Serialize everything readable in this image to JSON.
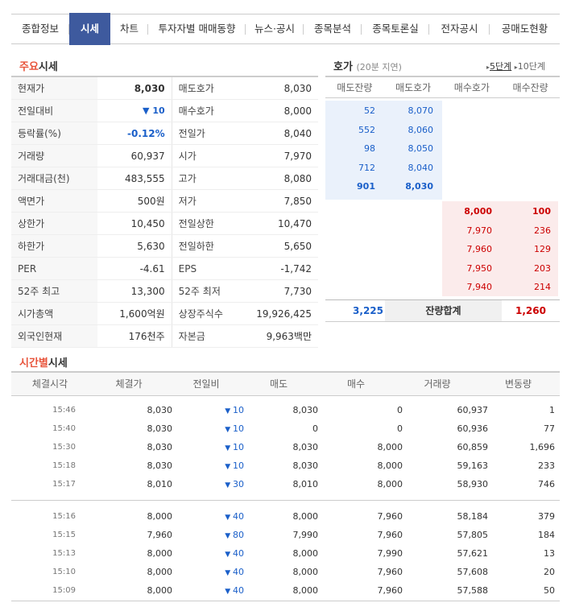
{
  "tabs": [
    "종합정보",
    "시세",
    "차트",
    "투자자별 매매동향",
    "뉴스·공시",
    "종목분석",
    "종목토론실",
    "전자공시",
    "공매도현황"
  ],
  "active_tab": "시세",
  "main_title": {
    "red": "주요",
    "rest": "시세"
  },
  "quote": [
    {
      "l1": "현재가",
      "v1": "8,030",
      "l2": "매도호가",
      "v2": "8,030"
    },
    {
      "l1": "전일대비",
      "v1": "▼ 10",
      "l2": "매수호가",
      "v2": "8,000"
    },
    {
      "l1": "등락률(%)",
      "v1": "-0.12%",
      "l2": "전일가",
      "v2": "8,040"
    },
    {
      "l1": "거래량",
      "v1": "60,937",
      "l2": "시가",
      "v2": "7,970"
    },
    {
      "l1": "거래대금(천)",
      "v1": "483,555",
      "l2": "고가",
      "v2": "8,080"
    },
    {
      "l1": "액면가",
      "v1": "500원",
      "l2": "저가",
      "v2": "7,850"
    },
    {
      "l1": "상한가",
      "v1": "10,450",
      "l2": "전일상한",
      "v2": "10,470"
    },
    {
      "l1": "하한가",
      "v1": "5,630",
      "l2": "전일하한",
      "v2": "5,650"
    },
    {
      "l1": "PER",
      "v1": "-4.61",
      "l2": "EPS",
      "v2": "-1,742"
    },
    {
      "l1": "52주 최고",
      "v1": "13,300",
      "l2": "52주 최저",
      "v2": "7,730"
    },
    {
      "l1": "시가총액",
      "v1": "1,600억원",
      "l2": "상장주식수",
      "v2": "19,926,425"
    },
    {
      "l1": "외국인현재",
      "v1": "176천주",
      "l2": "자본금",
      "v2": "9,963백만"
    }
  ],
  "book": {
    "title": "호가",
    "delay": "(20분 지연)",
    "step5": "5단계",
    "step10": "10단계",
    "headers": [
      "매도잔량",
      "매도호가",
      "매수호가",
      "매수잔량"
    ],
    "asks": [
      {
        "qty": "52",
        "price": "8,070"
      },
      {
        "qty": "552",
        "price": "8,060"
      },
      {
        "qty": "98",
        "price": "8,050"
      },
      {
        "qty": "712",
        "price": "8,040"
      },
      {
        "qty": "901",
        "price": "8,030"
      }
    ],
    "bids": [
      {
        "price": "8,000",
        "qty": "100"
      },
      {
        "price": "7,970",
        "qty": "236"
      },
      {
        "price": "7,960",
        "qty": "129"
      },
      {
        "price": "7,950",
        "qty": "203"
      },
      {
        "price": "7,940",
        "qty": "214"
      }
    ],
    "total_ask": "3,225",
    "total_label": "잔량합계",
    "total_bid": "1,260"
  },
  "time_title": {
    "red": "시간별",
    "rest": "시세"
  },
  "time_headers": [
    "체결시각",
    "체결가",
    "전일비",
    "매도",
    "매수",
    "거래량",
    "변동량"
  ],
  "time_rows": [
    [
      "15:46",
      "8,030",
      "10",
      "8,030",
      "0",
      "60,937",
      "1"
    ],
    [
      "15:40",
      "8,030",
      "10",
      "0",
      "0",
      "60,936",
      "77"
    ],
    [
      "15:30",
      "8,030",
      "10",
      "8,030",
      "8,000",
      "60,859",
      "1,696"
    ],
    [
      "15:18",
      "8,030",
      "10",
      "8,030",
      "8,000",
      "59,163",
      "233"
    ],
    [
      "15:17",
      "8,010",
      "30",
      "8,010",
      "8,000",
      "58,930",
      "746"
    ],
    [
      "15:16",
      "8,000",
      "40",
      "8,000",
      "7,960",
      "58,184",
      "379"
    ],
    [
      "15:15",
      "7,960",
      "80",
      "7,990",
      "7,960",
      "57,805",
      "184"
    ],
    [
      "15:13",
      "8,000",
      "40",
      "8,000",
      "7,990",
      "57,621",
      "13"
    ],
    [
      "15:10",
      "8,000",
      "40",
      "8,000",
      "7,960",
      "57,608",
      "20"
    ],
    [
      "15:09",
      "8,000",
      "40",
      "8,000",
      "7,960",
      "57,588",
      "50"
    ]
  ],
  "colors": {
    "accent": "#3e5a9e",
    "up": "#cc0000",
    "down": "#1a5fc9",
    "title_red": "#e8543b"
  }
}
